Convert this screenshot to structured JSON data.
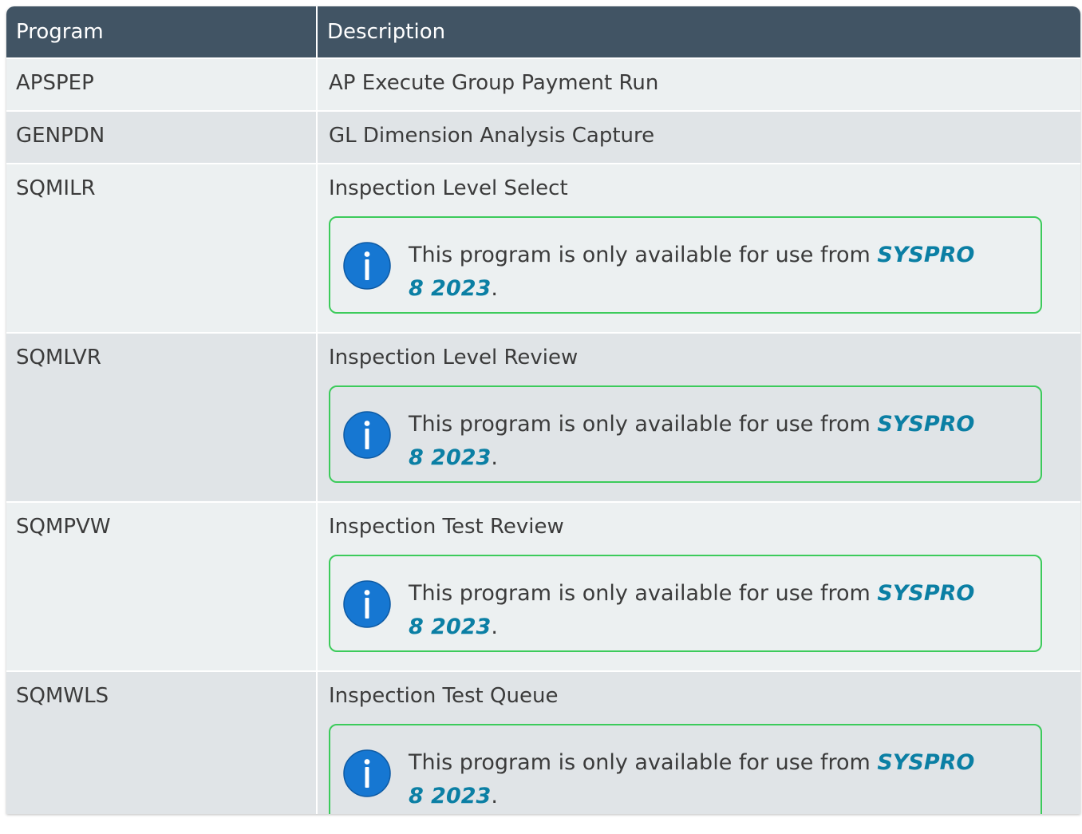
{
  "header": {
    "col_program": "Program",
    "col_description": "Description"
  },
  "rows": [
    {
      "program": "APSPEP",
      "description": "AP Execute Group Payment Run"
    },
    {
      "program": "GENPDN",
      "description": "GL Dimension Analysis Capture"
    },
    {
      "program": "SQMILR",
      "description": "Inspection Level Select"
    },
    {
      "program": "SQMLVR",
      "description": "Inspection Level Review"
    },
    {
      "program": "SQMPVW",
      "description": "Inspection Test Review"
    },
    {
      "program": "SQMWLS",
      "description": "Inspection Test Queue"
    }
  ],
  "note": {
    "text_before": "This program is only available for use from ",
    "product": "SYSPRO 8 2023",
    "text_after": ".",
    "icon": "info-icon"
  },
  "colors": {
    "header_bg": "#415464",
    "row_odd": "#ecf0f1",
    "row_even": "#e0e4e7",
    "note_border": "#3ccb5b",
    "icon_blue": "#1677d2",
    "product_link": "#0b7fa4"
  }
}
